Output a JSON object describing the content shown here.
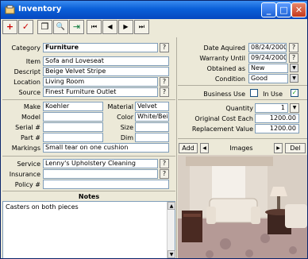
{
  "window": {
    "title": "Inventory",
    "min": "_",
    "max": "□",
    "close": "✕"
  },
  "toolbar": {
    "add": "+",
    "check": "✓",
    "copy": "❐",
    "find": "🔍",
    "exit": "⇥",
    "first": "⏮",
    "prev": "◀",
    "next": "▶",
    "last": "⏭"
  },
  "left": {
    "category_label": "Category",
    "category_value": "Furniture",
    "item_label": "Item",
    "item_value": "Sofa and Loveseat",
    "descript_label": "Descript",
    "descript_value": "Beige Velvet Stripe",
    "location_label": "Location",
    "location_value": "Living Room",
    "source_label": "Source",
    "source_value": "Finest Furniture Outlet",
    "make_label": "Make",
    "make_value": "Koehler",
    "material_label": "Material",
    "material_value": "Velvet",
    "model_label": "Model",
    "model_value": "",
    "color_label": "Color",
    "color_value": "White/Beige",
    "serial_label": "Serial #",
    "serial_value": "",
    "size_label": "Size",
    "size_value": "",
    "part_label": "Part #",
    "part_value": "",
    "dim_label": "Dim",
    "dim_value": "",
    "markings_label": "Markings",
    "markings_value": "Small tear on one cushion",
    "service_label": "Service",
    "service_value": "Lenny's Upholstery Cleaning",
    "insurance_label": "Insurance",
    "insurance_value": "",
    "policy_label": "Policy #",
    "policy_value": "",
    "help": "?"
  },
  "notes": {
    "header": "Notes",
    "text": "Casters on both pieces"
  },
  "right": {
    "date_acquired_label": "Date Aquired",
    "date_acquired_value": "08/24/2000",
    "warranty_label": "Warranty Until",
    "warranty_value": "09/24/2000",
    "obtained_label": "Obtained as",
    "obtained_value": "New",
    "condition_label": "Condition",
    "condition_value": "Good",
    "business_use_label": "Business Use",
    "in_use_label": "In Use",
    "in_use_mark": "✓",
    "quantity_label": "Quantity",
    "quantity_value": "1",
    "original_cost_label": "Original Cost Each",
    "original_cost_value": "1200.00",
    "replacement_label": "Replacement Value",
    "replacement_value": "1200.00",
    "dropdown_arrow": "▼"
  },
  "images": {
    "add": "Add",
    "label": "Images",
    "del": "Del",
    "prev": "◀",
    "next": "▶"
  },
  "colors": {
    "title_bar": "#0a5fd8",
    "window_bg": "#ece9d8",
    "close_red": "#c4381b",
    "toolbar_red": "#cc0000"
  }
}
